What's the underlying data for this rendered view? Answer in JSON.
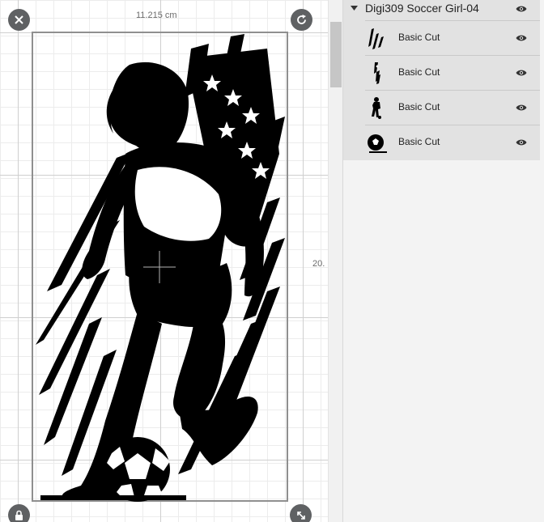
{
  "canvas": {
    "width_dimension": "11.215 cm",
    "height_dimension": "20."
  },
  "layers": {
    "group": {
      "title": "Digi309 Soccer Girl-04",
      "items": [
        {
          "label": "Basic Cut",
          "thumb": "flag-strokes-thumbnail"
        },
        {
          "label": "Basic Cut",
          "thumb": "flag-stars-thumbnail"
        },
        {
          "label": "Basic Cut",
          "thumb": "player-thumbnail"
        },
        {
          "label": "Basic Cut",
          "thumb": "soccer-ball-thumbnail"
        }
      ]
    }
  },
  "colors": {
    "handle": "#5f6163",
    "selection_border": "#8f8f8f",
    "panel_bg": "#f3f3f3",
    "group_bg": "#e2e2e2",
    "artwork": "#000000"
  }
}
